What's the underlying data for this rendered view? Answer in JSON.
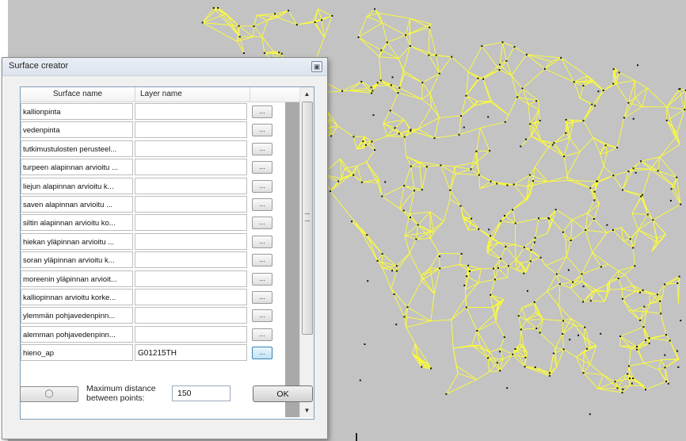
{
  "dialog": {
    "title": "Surface creator",
    "close_glyph": "▣",
    "columns": {
      "surface_name": "Surface name",
      "layer_name": "Layer name"
    },
    "rows": [
      {
        "surface": "kallionpinta",
        "layer": ""
      },
      {
        "surface": "vedenpinta",
        "layer": ""
      },
      {
        "surface": "tutkimustulosten perusteel...",
        "layer": ""
      },
      {
        "surface": "turpeen alapinnan arvioitu ...",
        "layer": ""
      },
      {
        "surface": "liejun alapinnan arvioitu k...",
        "layer": ""
      },
      {
        "surface": "saven alapinnan arvioitu ...",
        "layer": ""
      },
      {
        "surface": "siltin alapinnan arvioitu ko...",
        "layer": ""
      },
      {
        "surface": "hiekan yläpinnan arvioitu ...",
        "layer": ""
      },
      {
        "surface": "soran yläpinnan arvioitu k...",
        "layer": ""
      },
      {
        "surface": "moreenin yläpinnan arvioit...",
        "layer": ""
      },
      {
        "surface": "kalliopinnan arvioitu korke...",
        "layer": ""
      },
      {
        "surface": "ylemmän pohjavedenpinn...",
        "layer": ""
      },
      {
        "surface": "alemman pohjavedenpinn...",
        "layer": ""
      },
      {
        "surface": "hieno_ap",
        "layer": "G01215TH"
      }
    ],
    "browse_label": "...",
    "scroll_up": "▲",
    "scroll_down": "▼",
    "progress_label": "◯",
    "distance_label": "Maximum distance between points:",
    "distance_value": "150",
    "ok_label": "OK"
  },
  "colors": {
    "mesh": "#ffff33",
    "background": "#c3c3c3",
    "points": "#111111"
  }
}
